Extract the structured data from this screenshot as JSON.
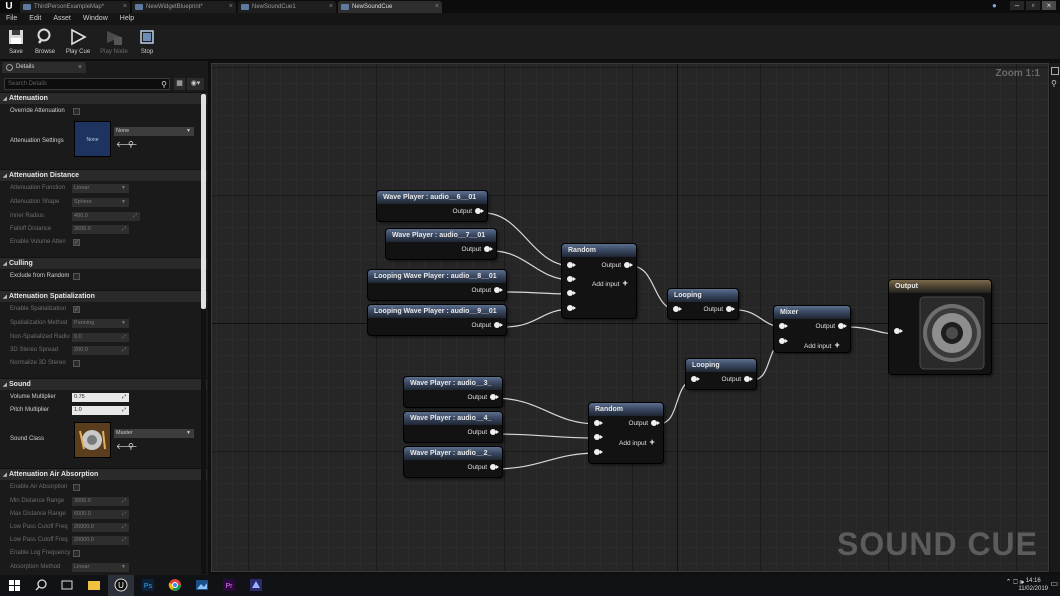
{
  "tabs": [
    {
      "label": "ThirdPersonExampleMap*",
      "active": false
    },
    {
      "label": "NewWidgetBlueprint*",
      "active": false
    },
    {
      "label": "NewSoundCue1",
      "active": false
    },
    {
      "label": "NewSoundCue",
      "active": true
    }
  ],
  "menu": [
    "File",
    "Edit",
    "Asset",
    "Window",
    "Help"
  ],
  "toolbar": {
    "save": "Save",
    "browse": "Browse",
    "play_cue": "Play Cue",
    "play_node": "Play Node",
    "stop": "Stop"
  },
  "details": {
    "tab_label": "Details",
    "search_placeholder": "Search Details",
    "sections": {
      "attenuation": "Attenuation",
      "attenuation_distance": "Attenuation Distance",
      "culling": "Culling",
      "attenuation_spatialization": "Attenuation Spatialization",
      "sound": "Sound",
      "attenuation_air_absorption": "Attenuation Air Absorption"
    },
    "override_attenuation": "Override Attenuation",
    "attenuation_settings": "Attenuation Settings",
    "attenuation_settings_thumb": "None",
    "attenuation_settings_value": "None",
    "attenuation_function": {
      "label": "Attenuation Function",
      "value": "Linear"
    },
    "attenuation_shape": {
      "label": "Attenuation Shape",
      "value": "Sphere"
    },
    "inner_radius": {
      "label": "Inner Radius",
      "value": "400.0"
    },
    "falloff_distance": {
      "label": "Falloff Distance",
      "value": "3600.0"
    },
    "enable_volume_atten": "Enable Volume Atten",
    "exclude_from_random": "Exclude from Random",
    "enable_spatialization": "Enable Spatialization",
    "spatialization_method": {
      "label": "Spatialization Method",
      "value": "Panning"
    },
    "non_spatialized_radius": {
      "label": "Non-Spatialized Radius",
      "value": "0.0"
    },
    "stereo_spread": {
      "label": "3D Stereo Spread",
      "value": "200.0"
    },
    "normalize_3d_stereo": "Normalize 3D Stereo",
    "volume_multiplier": {
      "label": "Volume Multiplier",
      "value": "0.75"
    },
    "pitch_multiplier": {
      "label": "Pitch Multiplier",
      "value": "1.0"
    },
    "sound_class": {
      "label": "Sound Class",
      "value": "Master"
    },
    "enable_air_absorption": "Enable Air Absorption",
    "min_distance_range": {
      "label": "Min Distance Range",
      "value": "3000.0"
    },
    "max_distance_range": {
      "label": "Max Distance Range",
      "value": "6000.0"
    },
    "lpf_cutoff_1": {
      "label": "Low Pass Cutoff Freq",
      "value": "20000.0"
    },
    "lpf_cutoff_2": {
      "label": "Low Pass Cutoff Freq",
      "value": "20000.0"
    },
    "enable_log_frequency": "Enable Log Frequency",
    "absorption_method": {
      "label": "Absorption Method",
      "value": "Linear"
    }
  },
  "graph": {
    "zoom": "Zoom 1:1",
    "watermark": "SOUND CUE",
    "nodes": {
      "wp6": {
        "title": "Wave Player : audio__6__01",
        "out": "Output"
      },
      "wp7": {
        "title": "Wave Player : audio__7__01",
        "out": "Output"
      },
      "lwp8": {
        "title": "Looping Wave Player : audio__8__01",
        "out": "Output"
      },
      "lwp9": {
        "title": "Looping Wave Player : audio__9__01",
        "out": "Output"
      },
      "random1": {
        "title": "Random",
        "out": "Output",
        "add": "Add input"
      },
      "looping1": {
        "title": "Looping",
        "out": "Output"
      },
      "mixer": {
        "title": "Mixer",
        "out": "Output",
        "add": "Add input"
      },
      "output": {
        "title": "Output"
      },
      "wp3": {
        "title": "Wave Player : audio__3_",
        "out": "Output"
      },
      "wp4": {
        "title": "Wave Player : audio__4_",
        "out": "Output"
      },
      "wp2": {
        "title": "Wave Player : audio__2_",
        "out": "Output"
      },
      "random2": {
        "title": "Random",
        "out": "Output",
        "add": "Add input"
      },
      "looping2": {
        "title": "Looping",
        "out": "Output"
      }
    }
  },
  "taskbar": {
    "time": "14:16",
    "date": "11/02/2019"
  }
}
